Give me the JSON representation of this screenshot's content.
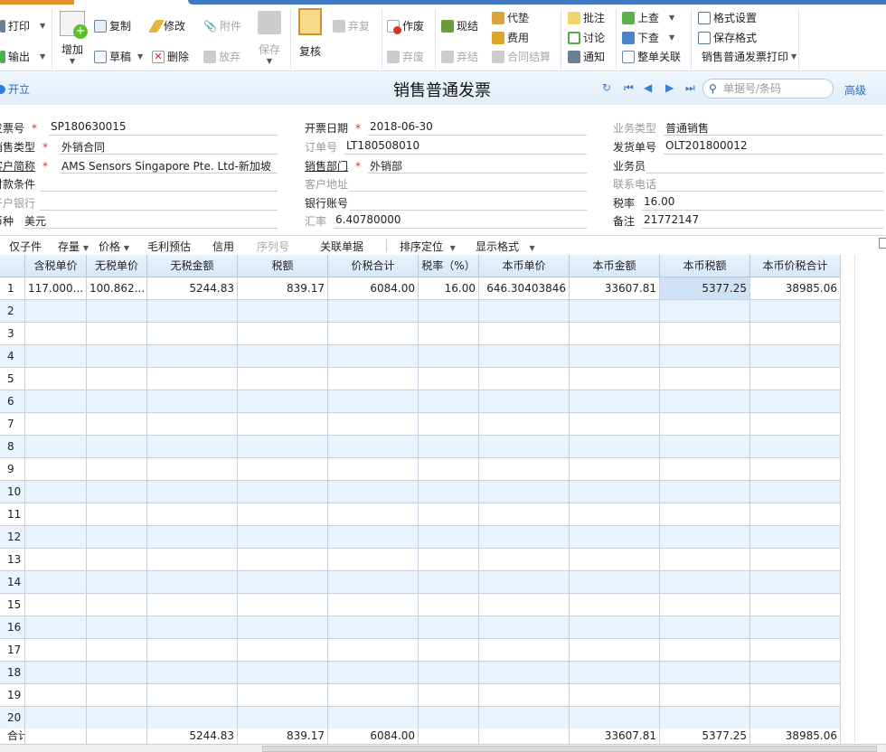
{
  "toolbar": {
    "print": "打印",
    "export": "输出",
    "add": "增加",
    "copy": "复制",
    "draft": "草稿",
    "edit": "修改",
    "delete": "删除",
    "attach": "附件",
    "discard": "放弃",
    "save": "保存",
    "review": "复核",
    "unreview": "弃复",
    "void": "作废",
    "unvoid": "弃废",
    "settle": "现结",
    "unsettle": "弃结",
    "advance": "代垫",
    "expense": "费用",
    "contract_settle": "合同结算",
    "annotate": "批注",
    "discuss": "讨论",
    "notify": "通知",
    "lookup_up": "上查",
    "lookup_down": "下查",
    "link_all": "整单关联",
    "format_settings": "格式设置",
    "save_format": "保存格式",
    "print_invoice": "销售普通发票打印"
  },
  "titlebar": {
    "open": "开立",
    "title": "销售普通发票",
    "search_placeholder": "单据号/条码",
    "advanced": "高级"
  },
  "form": {
    "invoice_no": {
      "label": "发票号",
      "value": "SP180630015"
    },
    "sales_type": {
      "label": "销售类型",
      "value": "外销合同"
    },
    "customer": {
      "label": "客户简称",
      "value": "AMS Sensors Singapore Pte. Ltd-新加坡"
    },
    "payment_terms": {
      "label": "付款条件",
      "value": ""
    },
    "bank": {
      "label": "开户银行",
      "value": ""
    },
    "currency": {
      "label": "币种",
      "value": "美元"
    },
    "invoice_date": {
      "label": "开票日期",
      "value": "2018-06-30"
    },
    "order_no": {
      "label": "订单号",
      "value": "LT180508010"
    },
    "dept": {
      "label": "销售部门",
      "value": "外销部"
    },
    "address": {
      "label": "客户地址",
      "value": ""
    },
    "account": {
      "label": "银行账号",
      "value": ""
    },
    "rate": {
      "label": "汇率",
      "value": "6.40780000"
    },
    "biz_type": {
      "label": "业务类型",
      "value": "普通销售"
    },
    "delivery_no": {
      "label": "发货单号",
      "value": "OLT201800012"
    },
    "salesman": {
      "label": "业务员",
      "value": ""
    },
    "phone": {
      "label": "联系电话",
      "value": ""
    },
    "tax_rate": {
      "label": "税率",
      "value": "16.00"
    },
    "remark": {
      "label": "备注",
      "value": "21772147"
    }
  },
  "grid_toolbar": {
    "child_only": "仅子件",
    "stock": "存量",
    "price": "价格",
    "margin": "毛利预估",
    "credit": "信用",
    "serial": "序列号",
    "related": "关联单据",
    "sort": "排序定位",
    "display": "显示格式"
  },
  "grid": {
    "columns": [
      "",
      "含税单价",
      "无税单价",
      "无税金额",
      "税额",
      "价税合计",
      "税率（%）",
      "本币单价",
      "本币金额",
      "本币税额",
      "本币价税合计"
    ],
    "rows": [
      [
        "1",
        "117.000...",
        "100.862...",
        "5244.83",
        "839.17",
        "6084.00",
        "16.00",
        "646.30403846",
        "33607.81",
        "5377.25",
        "38985.06"
      ]
    ],
    "row_count": 20,
    "total": [
      "合计",
      "",
      "",
      "5244.83",
      "839.17",
      "6084.00",
      "",
      "",
      "33607.81",
      "5377.25",
      "38985.06"
    ]
  }
}
